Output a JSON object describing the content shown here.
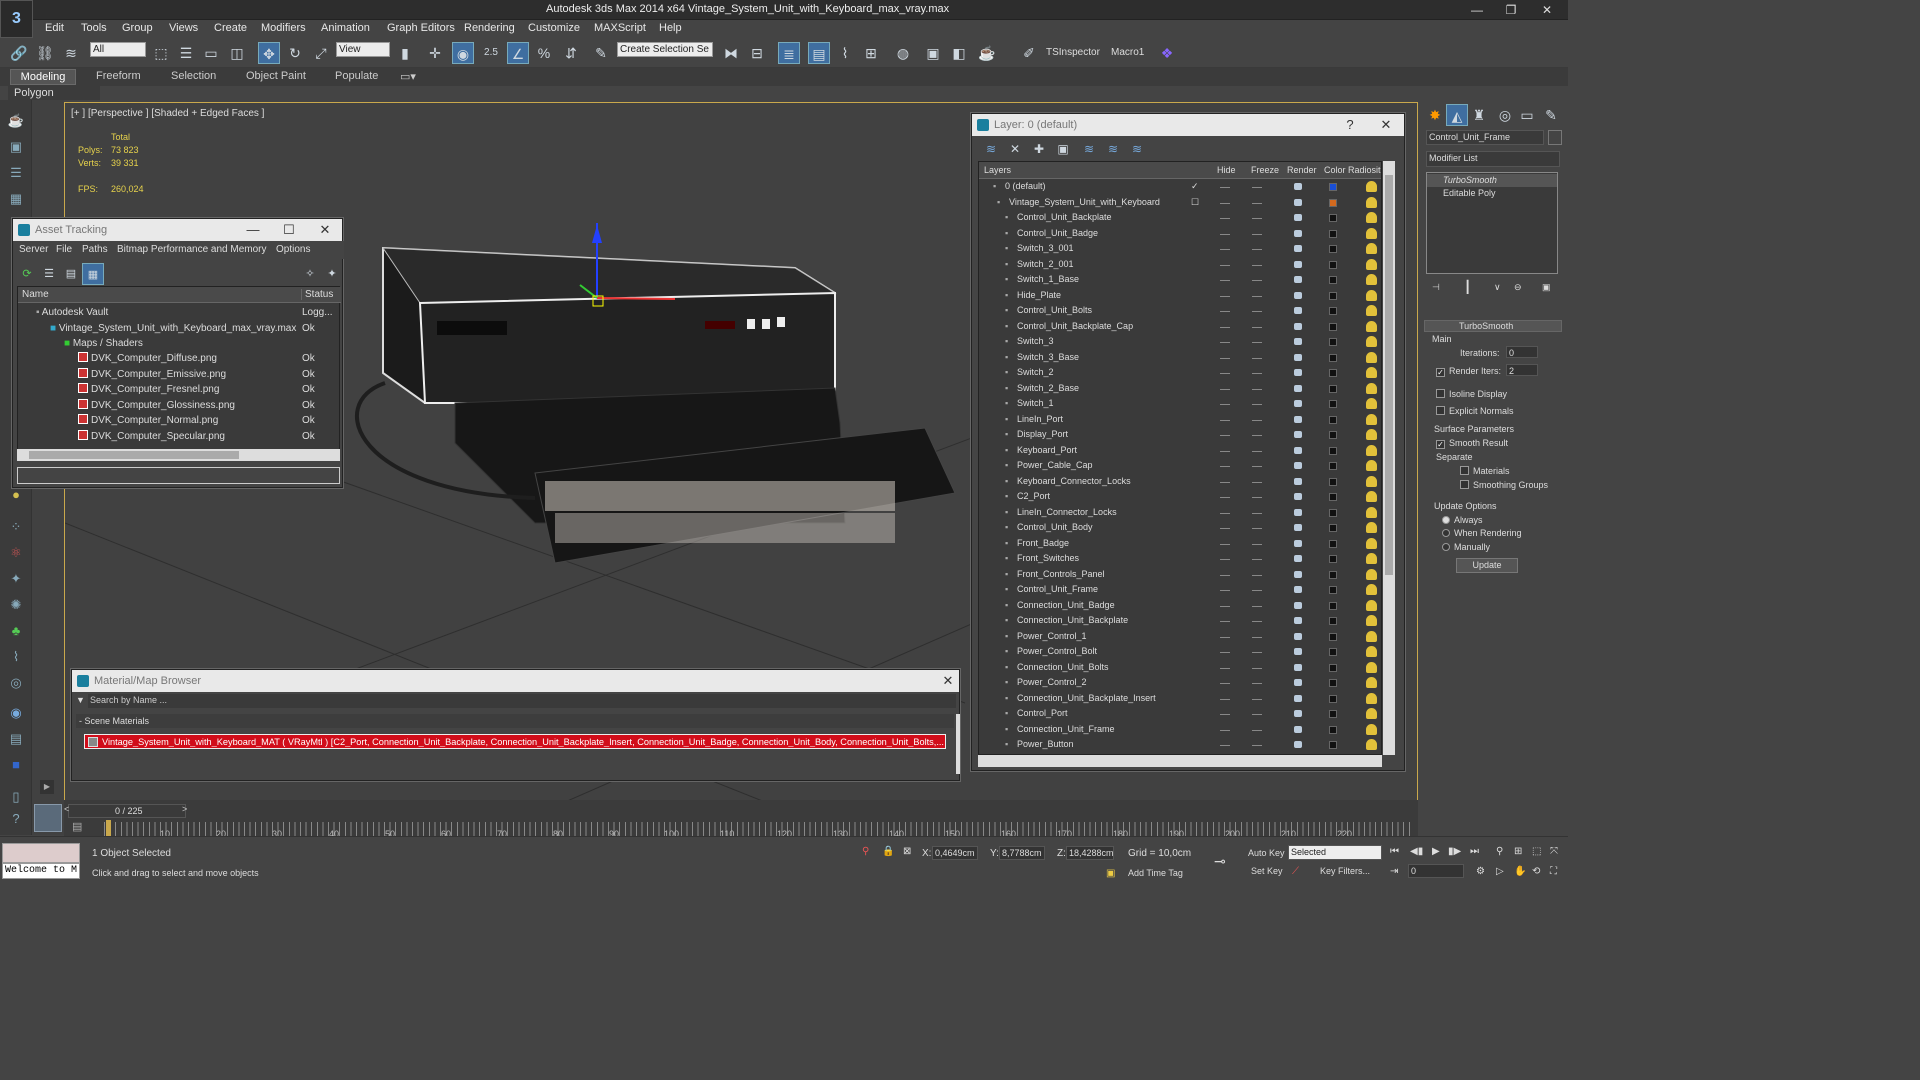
{
  "app": {
    "title": "Autodesk 3ds Max  2014 x64     Vintage_System_Unit_with_Keyboard_max_vray.max",
    "logo": "3"
  },
  "menu": [
    "Edit",
    "Tools",
    "Group",
    "Views",
    "Create",
    "Modifiers",
    "Animation",
    "Graph Editors",
    "Rendering",
    "Customize",
    "MAXScript",
    "Help"
  ],
  "toolbar": {
    "filter": "All",
    "refcoord": "View",
    "selset": "Create Selection Se",
    "snap_label": "2.5",
    "tsinspector": "TSInspector",
    "macro": "Macro1"
  },
  "ribbon": {
    "tabs": [
      "Modeling",
      "Freeform",
      "Selection",
      "Object Paint",
      "Populate"
    ],
    "panel": "Polygon Modeling"
  },
  "viewport": {
    "label": "[+ ] [Perspective ] [Shaded + Edged Faces ]",
    "total_label": "Total",
    "polys_label": "Polys:",
    "polys_value": "73 823",
    "verts_label": "Verts:",
    "verts_value": "39 331",
    "fps_label": "FPS:",
    "fps_value": "260,024"
  },
  "asset_tracking": {
    "title": "Asset Tracking",
    "menu": [
      "Server",
      "File",
      "Paths",
      "Bitmap Performance and Memory",
      "Options"
    ],
    "col_name": "Name",
    "col_status": "Status",
    "rows": [
      {
        "name": "Autodesk Vault",
        "status": "Logg..."
      },
      {
        "name": "Vintage_System_Unit_with_Keyboard_max_vray.max",
        "status": "Ok"
      },
      {
        "name": "Maps / Shaders",
        "status": ""
      },
      {
        "name": "DVK_Computer_Diffuse.png",
        "status": "Ok"
      },
      {
        "name": "DVK_Computer_Emissive.png",
        "status": "Ok"
      },
      {
        "name": "DVK_Computer_Fresnel.png",
        "status": "Ok"
      },
      {
        "name": "DVK_Computer_Glossiness.png",
        "status": "Ok"
      },
      {
        "name": "DVK_Computer_Normal.png",
        "status": "Ok"
      },
      {
        "name": "DVK_Computer_Specular.png",
        "status": "Ok"
      }
    ]
  },
  "material_browser": {
    "title": "Material/Map Browser",
    "search_placeholder": "Search by Name ...",
    "section": "- Scene Materials",
    "material": "Vintage_System_Unit_with_Keyboard_MAT ( VRayMtl ) [C2_Port, Connection_Unit_Backplate, Connection_Unit_Backplate_Insert, Connection_Unit_Badge, Connection_Unit_Body, Connection_Unit_Bolts,..."
  },
  "layer_manager": {
    "title": "Layer: 0 (default)",
    "help": "?",
    "columns": [
      "Layers",
      "Hide",
      "Freeze",
      "Render",
      "Color",
      "Radiosit"
    ],
    "layers": [
      {
        "name": "0 (default)",
        "indent": 1,
        "color": "#1a4fd6"
      },
      {
        "name": "Vintage_System_Unit_with_Keyboard",
        "indent": 0,
        "color": "#d2691e"
      },
      {
        "name": "Control_Unit_Backplate",
        "indent": 2,
        "color": "#111"
      },
      {
        "name": "Control_Unit_Badge",
        "indent": 2,
        "color": "#111"
      },
      {
        "name": "Switch_3_001",
        "indent": 2,
        "color": "#111"
      },
      {
        "name": "Switch_2_001",
        "indent": 2,
        "color": "#111"
      },
      {
        "name": "Switch_1_Base",
        "indent": 2,
        "color": "#111"
      },
      {
        "name": "Hide_Plate",
        "indent": 2,
        "color": "#111"
      },
      {
        "name": "Control_Unit_Bolts",
        "indent": 2,
        "color": "#111"
      },
      {
        "name": "Control_Unit_Backplate_Cap",
        "indent": 2,
        "color": "#111"
      },
      {
        "name": "Switch_3",
        "indent": 2,
        "color": "#111"
      },
      {
        "name": "Switch_3_Base",
        "indent": 2,
        "color": "#111"
      },
      {
        "name": "Switch_2",
        "indent": 2,
        "color": "#111"
      },
      {
        "name": "Switch_2_Base",
        "indent": 2,
        "color": "#111"
      },
      {
        "name": "Switch_1",
        "indent": 2,
        "color": "#111"
      },
      {
        "name": "LineIn_Port",
        "indent": 2,
        "color": "#111"
      },
      {
        "name": "Display_Port",
        "indent": 2,
        "color": "#111"
      },
      {
        "name": "Keyboard_Port",
        "indent": 2,
        "color": "#111"
      },
      {
        "name": "Power_Cable_Cap",
        "indent": 2,
        "color": "#111"
      },
      {
        "name": "Keyboard_Connector_Locks",
        "indent": 2,
        "color": "#111"
      },
      {
        "name": "C2_Port",
        "indent": 2,
        "color": "#111"
      },
      {
        "name": "LineIn_Connector_Locks",
        "indent": 2,
        "color": "#111"
      },
      {
        "name": "Control_Unit_Body",
        "indent": 2,
        "color": "#111"
      },
      {
        "name": "Front_Badge",
        "indent": 2,
        "color": "#111"
      },
      {
        "name": "Front_Switches",
        "indent": 2,
        "color": "#111"
      },
      {
        "name": "Front_Controls_Panel",
        "indent": 2,
        "color": "#111"
      },
      {
        "name": "Control_Unit_Frame",
        "indent": 2,
        "color": "#111"
      },
      {
        "name": "Connection_Unit_Badge",
        "indent": 2,
        "color": "#111"
      },
      {
        "name": "Connection_Unit_Backplate",
        "indent": 2,
        "color": "#111"
      },
      {
        "name": "Power_Control_1",
        "indent": 2,
        "color": "#111"
      },
      {
        "name": "Power_Control_Bolt",
        "indent": 2,
        "color": "#111"
      },
      {
        "name": "Connection_Unit_Bolts",
        "indent": 2,
        "color": "#111"
      },
      {
        "name": "Power_Control_2",
        "indent": 2,
        "color": "#111"
      },
      {
        "name": "Connection_Unit_Backplate_Insert",
        "indent": 2,
        "color": "#111"
      },
      {
        "name": "Control_Port",
        "indent": 2,
        "color": "#111"
      },
      {
        "name": "Connection_Unit_Frame",
        "indent": 2,
        "color": "#111"
      },
      {
        "name": "Power_Button",
        "indent": 2,
        "color": "#111"
      }
    ]
  },
  "command_panel": {
    "object_name": "Control_Unit_Frame",
    "modifier_list": "Modifier List",
    "stack": [
      "TurboSmooth",
      "Editable Poly"
    ],
    "rollout": "TurboSmooth",
    "main": "Main",
    "iterations_label": "Iterations:",
    "iterations": "0",
    "render_iters_label": "Render Iters:",
    "render_iters": "2",
    "isoline": "Isoline Display",
    "explicit": "Explicit Normals",
    "surface": "Surface Parameters",
    "smooth_result": "Smooth Result",
    "separate": "Separate",
    "materials": "Materials",
    "smoothing_groups": "Smoothing Groups",
    "update_options": "Update Options",
    "always": "Always",
    "when_rendering": "When Rendering",
    "manually": "Manually",
    "update": "Update"
  },
  "timeline": {
    "frame": "0 / 225",
    "ticks": [
      "10",
      "20",
      "30",
      "40",
      "50",
      "60",
      "70",
      "80",
      "90",
      "100",
      "110",
      "120",
      "130",
      "140",
      "150",
      "160",
      "170",
      "180",
      "190",
      "200",
      "210",
      "220"
    ]
  },
  "status": {
    "maxscript": "Welcome to M",
    "selected": "1 Object Selected",
    "hint": "Click and drag to select and move objects",
    "x_label": "X:",
    "x": "0,4649cm",
    "y_label": "Y:",
    "y": "8,7788cm",
    "z_label": "Z:",
    "z": "18,4288cm",
    "grid": "Grid = 10,0cm",
    "add_time_tag": "Add Time Tag",
    "auto_key": "Auto Key",
    "set_key": "Set Key",
    "selected_combo": "Selected",
    "key_filters": "Key Filters...",
    "frame_field": "0"
  }
}
